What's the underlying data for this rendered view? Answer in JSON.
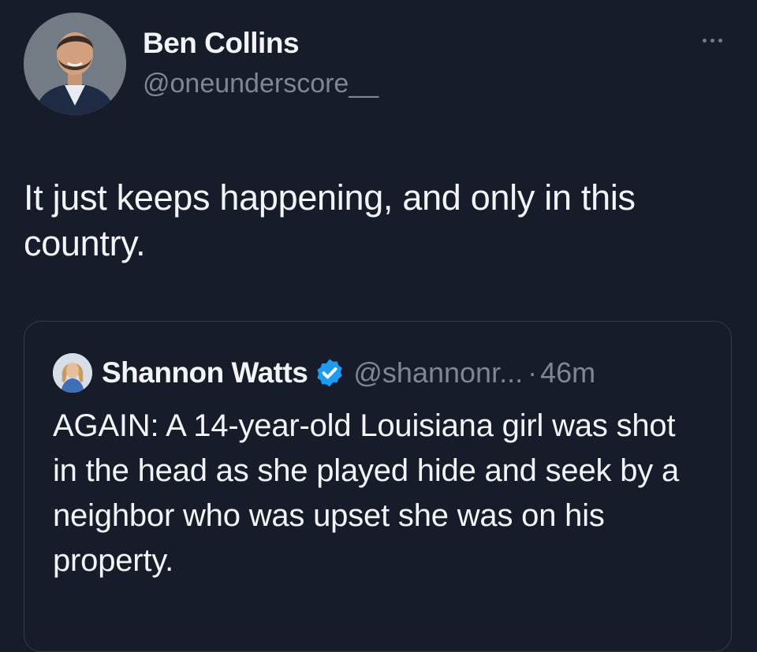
{
  "tweet": {
    "author": {
      "display_name": "Ben Collins",
      "handle": "@oneunderscore__"
    },
    "more_icon": "more-horizontal-icon",
    "text": "It just keeps happening, and only in this country."
  },
  "quoted_tweet": {
    "author": {
      "display_name": "Shannon Watts",
      "handle": "@shannonr...",
      "verified_icon": "verified-badge-icon"
    },
    "separator": "·",
    "time": "46m",
    "text": "AGAIN: A 14-year-old Louisiana girl was shot in the head as she played hide and seek by a neighbor who was upset she was on his property."
  },
  "colors": {
    "background": "#161c2a",
    "primary_text": "#f2f4f7",
    "secondary_text": "#7d8795",
    "verified": "#1d9bf0",
    "card_border": "#333c4b"
  }
}
